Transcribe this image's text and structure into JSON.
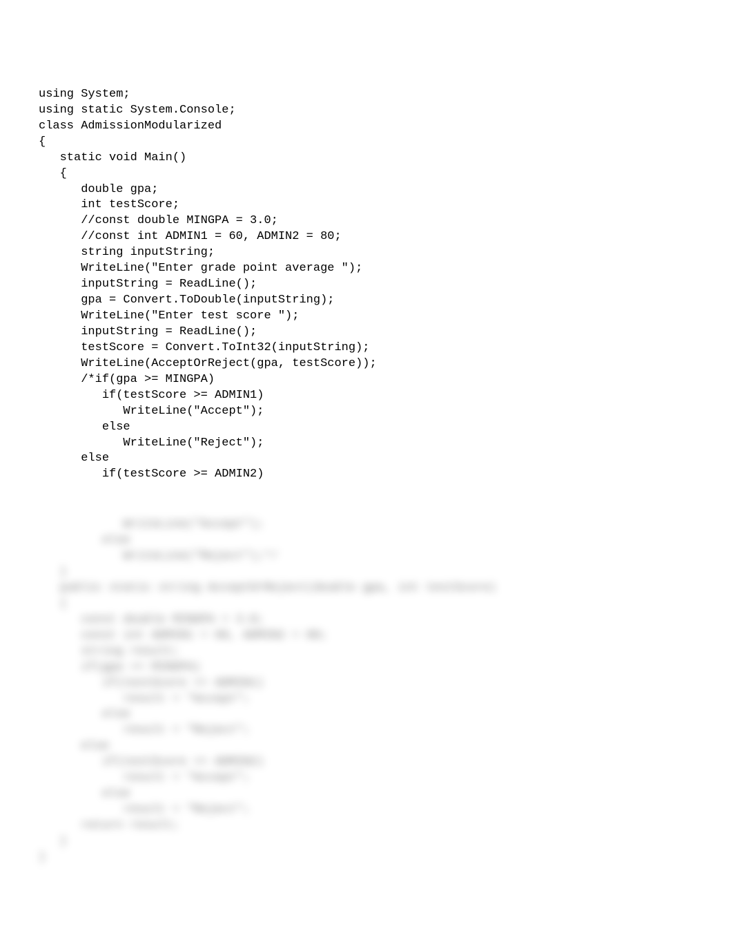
{
  "code": {
    "lines": [
      "using System;",
      "using static System.Console;",
      "class AdmissionModularized",
      "{",
      "   static void Main()",
      "   {",
      "      double gpa;",
      "      int testScore;",
      "      //const double MINGPA = 3.0;",
      "      //const int ADMIN1 = 60, ADMIN2 = 80;",
      "      string inputString;",
      "      WriteLine(\"Enter grade point average \");",
      "      inputString = ReadLine();",
      "      gpa = Convert.ToDouble(inputString);",
      "      WriteLine(\"Enter test score \");",
      "      inputString = ReadLine();",
      "      testScore = Convert.ToInt32(inputString);",
      "      WriteLine(AcceptOrReject(gpa, testScore));",
      "      /*if(gpa >= MINGPA)",
      "         if(testScore >= ADMIN1)",
      "            WriteLine(\"Accept\");",
      "         else",
      "            WriteLine(\"Reject\");",
      "      else",
      "         if(testScore >= ADMIN2)"
    ],
    "blurred": [
      "            WriteLine(\"Accept\");",
      "         else",
      "            WriteLine(\"Reject\");*/",
      "   }",
      "   public static string AcceptOrReject(double gpa, int testScore)",
      "   {",
      "      const double MINGPA = 3.0;",
      "      const int ADMIN1 = 60, ADMIN2 = 80;",
      "      string result;",
      "      if(gpa >= MINGPA)",
      "         if(testScore >= ADMIN1)",
      "            result = \"Accept\";",
      "         else",
      "            result = \"Reject\";",
      "      else",
      "         if(testScore >= ADMIN2)",
      "            result = \"Accept\";",
      "         else",
      "            result = \"Reject\";",
      "      return result;",
      "   }",
      "}"
    ]
  }
}
